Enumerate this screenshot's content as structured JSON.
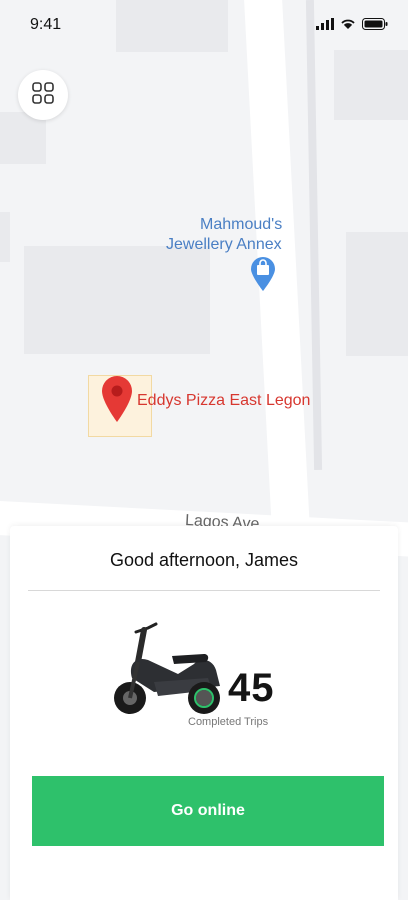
{
  "status": {
    "time": "9:41"
  },
  "map": {
    "poi_jewellery_line1": "Mahmoud's",
    "poi_jewellery_line2": "Jewellery Annex",
    "poi_pizza": "Eddys Pizza East Legon",
    "street": "Lagos Ave"
  },
  "icons": {
    "menu": "grid-icon",
    "shopping": "shopping-bag-pin-icon",
    "marker": "map-marker-icon"
  },
  "colors": {
    "primary_green": "#2ec16b",
    "marker_red": "#e53935",
    "poi_blue": "#4a7fc4"
  },
  "sheet": {
    "greeting": "Good afternoon, James",
    "trips_count": "45",
    "trips_label": "Completed Trips",
    "cta": "Go online"
  }
}
